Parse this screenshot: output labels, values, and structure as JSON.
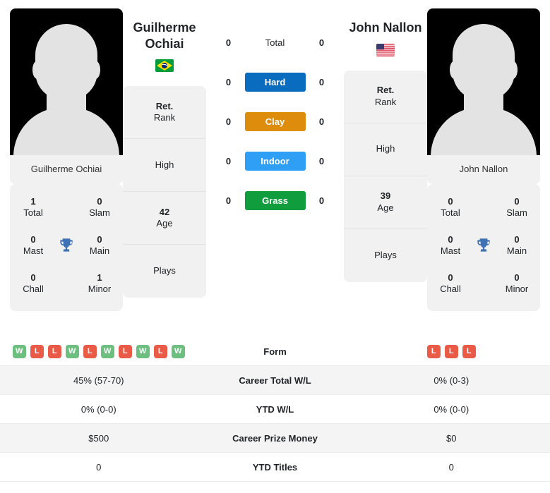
{
  "players": {
    "left": {
      "name": "Guilherme Ochiai",
      "name_line1": "Guilherme",
      "name_line2": "Ochiai",
      "photo_caption": "Guilherme Ochiai",
      "country": "Brazil",
      "flag_icon": "flag-brazil",
      "titles": {
        "total_num": "1",
        "total_label": "Total",
        "slam_num": "0",
        "slam_label": "Slam",
        "mast_num": "0",
        "mast_label": "Mast",
        "main_num": "0",
        "main_label": "Main",
        "chall_num": "0",
        "chall_label": "Chall",
        "minor_num": "1",
        "minor_label": "Minor"
      },
      "info": {
        "rank_value": "Ret.",
        "rank_label": "Rank",
        "high_value": "",
        "high_label": "High",
        "age_value": "42",
        "age_label": "Age",
        "plays_value": "",
        "plays_label": "Plays"
      },
      "surfaces": {
        "total": "0",
        "hard": "0",
        "clay": "0",
        "indoor": "0",
        "grass": "0"
      },
      "form": [
        "W",
        "L",
        "L",
        "W",
        "L",
        "W",
        "L",
        "W",
        "L",
        "W"
      ],
      "career_total_wl": "45% (57-70)",
      "ytd_wl": "0% (0-0)",
      "career_prize_money": "$500",
      "ytd_titles": "0"
    },
    "right": {
      "name": "John Nallon",
      "name_line1": "John Nallon",
      "name_line2": "",
      "photo_caption": "John Nallon",
      "country": "United States",
      "flag_icon": "flag-usa",
      "titles": {
        "total_num": "0",
        "total_label": "Total",
        "slam_num": "0",
        "slam_label": "Slam",
        "mast_num": "0",
        "mast_label": "Mast",
        "main_num": "0",
        "main_label": "Main",
        "chall_num": "0",
        "chall_label": "Chall",
        "minor_num": "0",
        "minor_label": "Minor"
      },
      "info": {
        "rank_value": "Ret.",
        "rank_label": "Rank",
        "high_value": "",
        "high_label": "High",
        "age_value": "39",
        "age_label": "Age",
        "plays_value": "",
        "plays_label": "Plays"
      },
      "surfaces": {
        "total": "0",
        "hard": "0",
        "clay": "0",
        "indoor": "0",
        "grass": "0"
      },
      "form": [
        "L",
        "L",
        "L"
      ],
      "career_total_wl": "0% (0-3)",
      "ytd_wl": "0% (0-0)",
      "career_prize_money": "$0",
      "ytd_titles": "0"
    }
  },
  "surface_labels": {
    "total": "Total",
    "hard": "Hard",
    "clay": "Clay",
    "indoor": "Indoor",
    "grass": "Grass"
  },
  "surface_colors": {
    "total": "transparent",
    "hard": "#0a6cbf",
    "clay": "#dd8c0c",
    "indoor": "#2f9ef5",
    "grass": "#0f9d3e"
  },
  "table_labels": {
    "form": "Form",
    "career_total_wl": "Career Total W/L",
    "ytd_wl": "YTD W/L",
    "career_prize_money": "Career Prize Money",
    "ytd_titles": "YTD Titles"
  },
  "form_colors": {
    "win": "#6cbf7f",
    "loss": "#ea5b47"
  },
  "icons": {
    "trophy": "trophy-icon"
  }
}
